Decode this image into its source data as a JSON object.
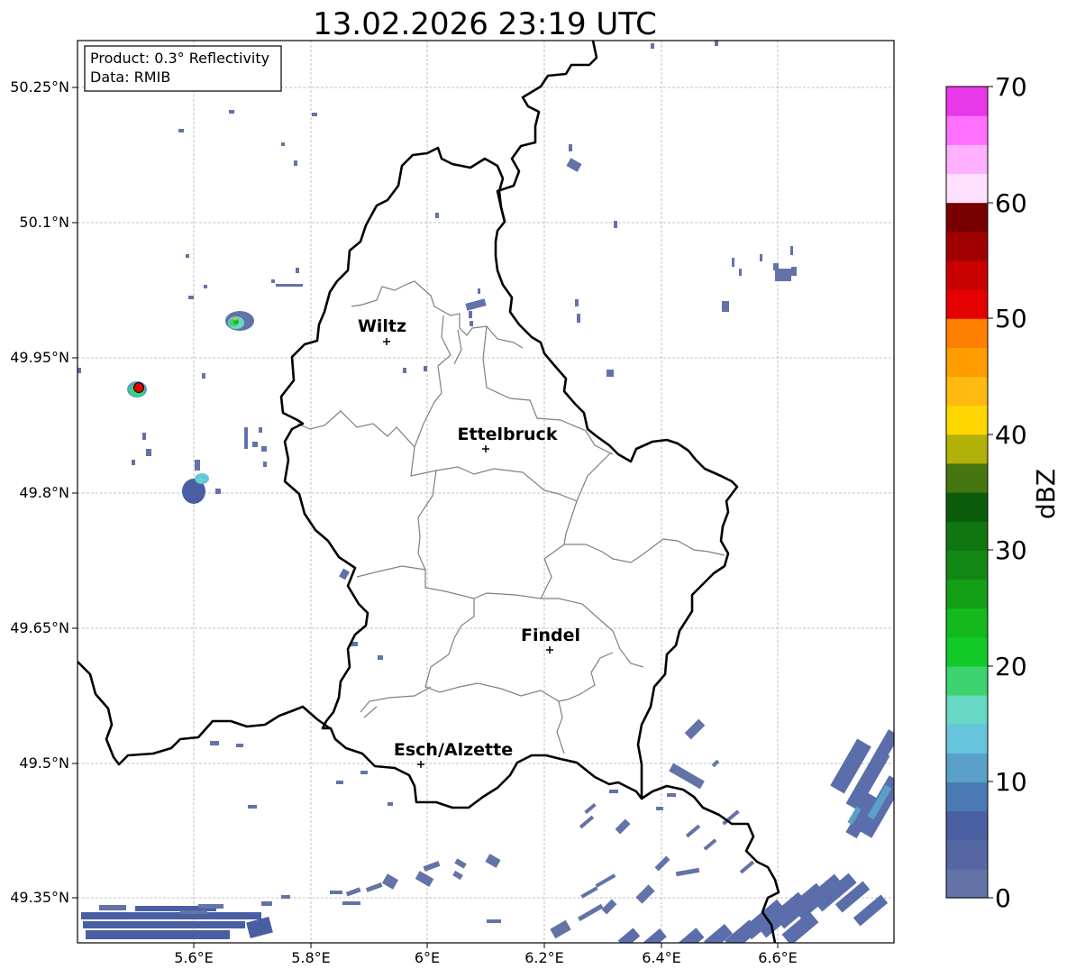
{
  "title": "13.02.2026 23:19 UTC",
  "info_box": {
    "product": "Product: 0.3° Reflectivity",
    "data": "Data: RMIB"
  },
  "x_ticks": [
    "5.6°E",
    "5.8°E",
    "6°E",
    "6.2°E",
    "6.4°E",
    "6.6°E"
  ],
  "y_ticks": [
    "50.25°N",
    "50.1°N",
    "49.95°N",
    "49.8°N",
    "49.65°N",
    "49.5°N",
    "49.35°N"
  ],
  "cities": [
    {
      "name": "Wiltz"
    },
    {
      "name": "Ettelbruck"
    },
    {
      "name": "Findel"
    },
    {
      "name": "Esch/Alzette"
    }
  ],
  "colorbar": {
    "label": "dBZ",
    "tick_labels": [
      "0",
      "10",
      "20",
      "30",
      "40",
      "50",
      "60",
      "70"
    ],
    "colors": [
      "#6373a8",
      "#5466a3",
      "#4a5fa2",
      "#4a7ab3",
      "#5aa0c8",
      "#66c4dc",
      "#66d8c4",
      "#3dd470",
      "#13c927",
      "#13b91d",
      "#139f16",
      "#138713",
      "#0f7610",
      "#0a5c0a",
      "#45760f",
      "#b1b10a",
      "#ffd700",
      "#ffb90f",
      "#ff9c00",
      "#ff7f00",
      "#e50000",
      "#c80000",
      "#a00000",
      "#780000",
      "#ffe0ff",
      "#ffb0ff",
      "#ff70ff",
      "#e838e8"
    ]
  },
  "style": {
    "border_color": "#000000",
    "district_color": "#808080",
    "grid_color": "#b4b4b4"
  }
}
